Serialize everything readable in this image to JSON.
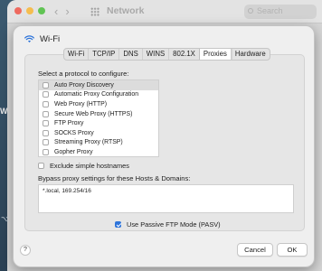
{
  "background_window": {
    "title": "Network",
    "search_placeholder": "Search",
    "side_letter": "W",
    "side_glyph": "⌥"
  },
  "sheet": {
    "title": "Wi-Fi",
    "tabs": [
      {
        "label": "Wi-Fi",
        "active": false
      },
      {
        "label": "TCP/IP",
        "active": false
      },
      {
        "label": "DNS",
        "active": false
      },
      {
        "label": "WINS",
        "active": false
      },
      {
        "label": "802.1X",
        "active": false
      },
      {
        "label": "Proxies",
        "active": true
      },
      {
        "label": "Hardware",
        "active": false
      }
    ],
    "protocol_prompt": "Select a protocol to configure:",
    "protocols": [
      {
        "label": "Auto Proxy Discovery",
        "checked": false,
        "selected": true
      },
      {
        "label": "Automatic Proxy Configuration",
        "checked": false,
        "selected": false
      },
      {
        "label": "Web Proxy (HTTP)",
        "checked": false,
        "selected": false
      },
      {
        "label": "Secure Web Proxy (HTTPS)",
        "checked": false,
        "selected": false
      },
      {
        "label": "FTP Proxy",
        "checked": false,
        "selected": false
      },
      {
        "label": "SOCKS Proxy",
        "checked": false,
        "selected": false
      },
      {
        "label": "Streaming Proxy (RTSP)",
        "checked": false,
        "selected": false
      },
      {
        "label": "Gopher Proxy",
        "checked": false,
        "selected": false
      }
    ],
    "exclude_simple": {
      "label": "Exclude simple hostnames",
      "checked": false
    },
    "bypass_label": "Bypass proxy settings for these Hosts & Domains:",
    "bypass_value": "*.local, 169.254/16",
    "passive_ftp": {
      "label": "Use Passive FTP Mode (PASV)",
      "checked": true
    },
    "help_label": "?",
    "cancel_label": "Cancel",
    "ok_label": "OK"
  },
  "colors": {
    "accent": "#2d74da",
    "window_bg": "#efefef"
  }
}
